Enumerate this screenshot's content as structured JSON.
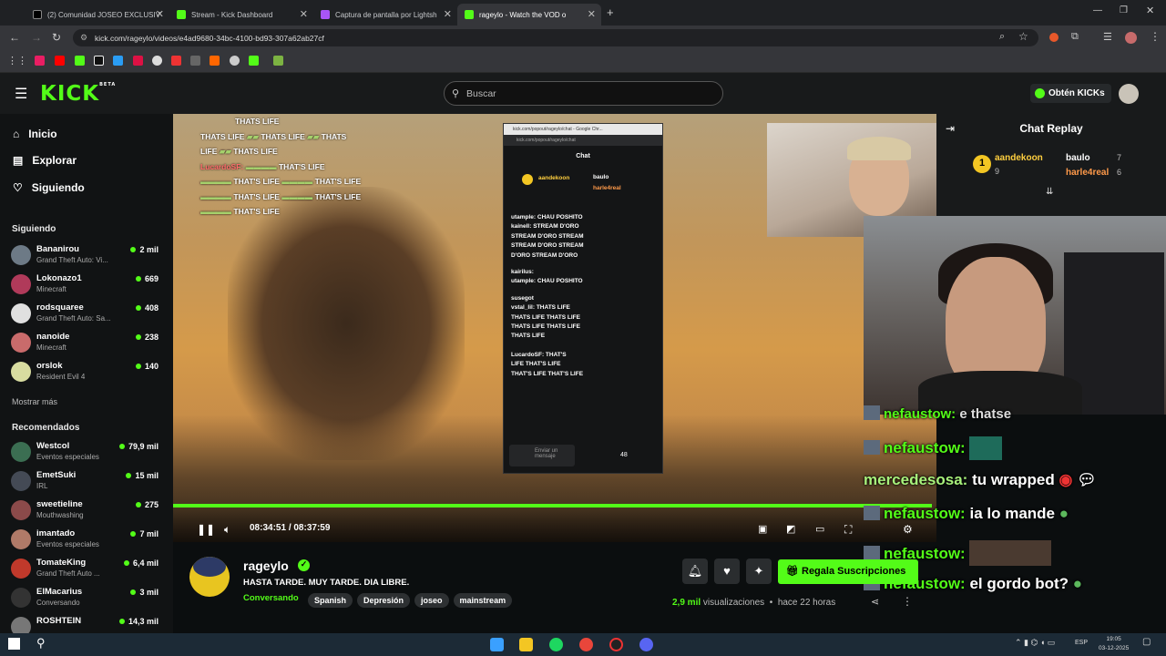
{
  "browser": {
    "tabs": [
      {
        "title": "(2) Comunidad JOSEO EXCLUSIV",
        "favicon_color": "#000000"
      },
      {
        "title": "Stream - Kick Dashboard",
        "favicon_color": "#53fc18"
      },
      {
        "title": "Captura de pantalla por Lightsh",
        "favicon_color": "#a855f7"
      },
      {
        "title": "rageylo - Watch the VOD o",
        "favicon_color": "#53fc18"
      }
    ],
    "url": "kick.com/rageylo/videos/e4ad9680-34bc-4100-bd93-307a62ab27cf"
  },
  "header": {
    "logo": "KICK",
    "logo_badge": "BETA",
    "search_placeholder": "Buscar",
    "kicks_label": "Obtén KICKs"
  },
  "sidebar": {
    "nav": [
      {
        "label": "Inicio",
        "icon": "home-icon"
      },
      {
        "label": "Explorar",
        "icon": "compass-icon"
      },
      {
        "label": "Siguiendo",
        "icon": "heart-icon"
      }
    ],
    "following_title": "Siguiendo",
    "following": [
      {
        "name": "Bananirou",
        "game": "Grand Theft Auto: Vi...",
        "viewers": "2 mil",
        "color": "#6d7a86"
      },
      {
        "name": "Lokonazo1",
        "game": "Minecraft",
        "viewers": "669",
        "color": "#b03a5a"
      },
      {
        "name": "rodsquaree",
        "game": "Grand Theft Auto: Sa...",
        "viewers": "408",
        "color": "#e0e0e0"
      },
      {
        "name": "nanoide",
        "game": "Minecraft",
        "viewers": "238",
        "color": "#c96b6b"
      },
      {
        "name": "orslok",
        "game": "Resident Evil 4",
        "viewers": "140",
        "color": "#d8dca0"
      }
    ],
    "show_more": "Mostrar más",
    "recommended_title": "Recomendados",
    "recommended": [
      {
        "name": "Westcol",
        "game": "Eventos especiales",
        "viewers": "79,9 mil",
        "color": "#3b6e52"
      },
      {
        "name": "EmetSuki",
        "game": "IRL",
        "viewers": "15 mil",
        "color": "#444a55"
      },
      {
        "name": "sweetieline",
        "game": "Mouthwashing",
        "viewers": "275",
        "color": "#8b4a4a"
      },
      {
        "name": "imantado",
        "game": "Eventos especiales",
        "viewers": "7 mil",
        "color": "#b07a68"
      },
      {
        "name": "TomateKing",
        "game": "Grand Theft Auto ...",
        "viewers": "6,4 mil",
        "color": "#c0392b"
      },
      {
        "name": "ElMacarius",
        "game": "Conversando",
        "viewers": "3 mil",
        "color": "#333333"
      },
      {
        "name": "ROSHTEIN",
        "game": "",
        "viewers": "14,3 mil",
        "color": "#777777"
      }
    ]
  },
  "video": {
    "chat_overlay_top": [
      "THATS LIFE",
      "THATS LIFE",
      "THATS",
      "THATS LIFE",
      "LucardoSF:",
      "THAT'S LIFE",
      "THAT'S LIFE",
      "THAT'S LIFE",
      "THAT'S LIFE",
      "THAT'S LIFE",
      "THAT'S LIFE"
    ],
    "popup": {
      "window_title": "kick.com/popout/rageylo/chat - Google Chr...",
      "url": "kick.com/popout/rageylo/chat",
      "title": "Chat",
      "pinned_user1": "aandekoon",
      "pinned_user2": "baulo",
      "pinned_user3": "harle4real",
      "lines": [
        "utample: CHAU POSHITO",
        "kainell: STREAM D'ORO",
        "STREAM D'ORO STREAM",
        "STREAM D'ORO STREAM",
        "D'ORO STREAM D'ORO",
        "kairilus:",
        "utample: CHAU POSHITO",
        "susegot",
        "vstal_lil: THATS LIFE",
        "THATS LIFE THATS LIFE",
        "THATS LIFE THATS LIFE",
        "THATS LIFE",
        "LucardoSF: THAT'S",
        "LIFE THAT'S LIFE",
        "THAT'S LIFE THAT'S LIFE"
      ],
      "send_placeholder": "Enviar un mensaje",
      "count": "48"
    },
    "time_current": "08:34:51",
    "time_separator": "/",
    "time_total": "08:37:59",
    "progress": 0.994
  },
  "overlay_chat": [
    {
      "user": "nefaustow:",
      "text": "e thatse",
      "partial": true
    },
    {
      "user": "nefaustow:",
      "text": ""
    },
    {
      "user": "mercedesosa:",
      "text": "tu wrapped"
    },
    {
      "user": "nefaustow:",
      "text": "ia lo mande"
    },
    {
      "user": "nefaustow:",
      "text": ""
    },
    {
      "user": "nefaustow:",
      "text": "el gordo bot?"
    }
  ],
  "chat_replay": {
    "title": "Chat Replay",
    "gifters": [
      {
        "name": "aandekoon",
        "count": "9",
        "rank": "1"
      },
      {
        "name": "baulo",
        "count": "7"
      },
      {
        "name": "harle4real",
        "count": "6"
      }
    ]
  },
  "channel": {
    "name": "rageylo",
    "stream_title": "HASTA TARDE. MUY TARDE. DIA LIBRE.",
    "category": "Conversando",
    "tags": [
      "Spanish",
      "Depresión",
      "joseo",
      "mainstream"
    ],
    "subscribe_label": "Regala Suscripciones",
    "views": "2,9 mil",
    "views_label": "visualizaciones",
    "time_ago": "hace 22 horas"
  },
  "taskbar": {
    "lang": "ESP",
    "time": "19:05",
    "date": "03-12-2025"
  },
  "colors": {
    "accent": "#53fc18",
    "bg": "#0b0e0f"
  }
}
